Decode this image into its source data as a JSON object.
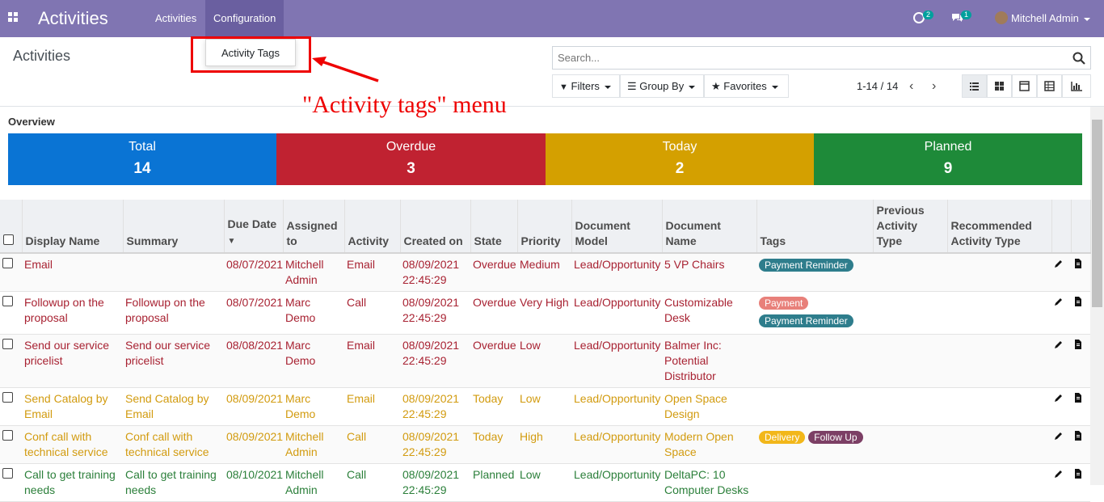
{
  "navbar": {
    "brand": "Activities",
    "menus": [
      "Activities",
      "Configuration"
    ],
    "activity_badge": "2",
    "messages_badge": "1",
    "user_name": "Mitchell Admin"
  },
  "dropdown": {
    "item": "Activity Tags"
  },
  "annotation": "\"Activity tags\" menu",
  "control_panel": {
    "title": "Activities",
    "search_placeholder": "Search...",
    "filters": "Filters",
    "group_by": "Group By",
    "favorites": "Favorites",
    "pager": "1-14 / 14"
  },
  "overview": {
    "label": "Overview",
    "stats": [
      {
        "label": "Total",
        "value": "14",
        "color": "#0a74d4"
      },
      {
        "label": "Overdue",
        "value": "3",
        "color": "#c02231"
      },
      {
        "label": "Today",
        "value": "2",
        "color": "#d4a000"
      },
      {
        "label": "Planned",
        "value": "9",
        "color": "#1e8a39"
      }
    ]
  },
  "table": {
    "headers": [
      "Display Name",
      "Summary",
      "Due Date",
      "Assigned to",
      "Activity",
      "Created on",
      "State",
      "Priority",
      "Document Model",
      "Document Name",
      "Tags",
      "Previous Activity Type",
      "Recommended Activity Type"
    ],
    "rows": [
      {
        "display_name": "Email",
        "summary": "",
        "due_date": "08/07/2021",
        "assigned_to": "Mitchell Admin",
        "activity": "Email",
        "created_on": "08/09/2021 22:45:29",
        "state": "Overdue",
        "priority": "Medium",
        "model": "Lead/Opportunity",
        "doc_name": "5 VP Chairs",
        "tags": [
          "Payment Reminder"
        ]
      },
      {
        "display_name": "Followup on the proposal",
        "summary": "Followup on the proposal",
        "due_date": "08/07/2021",
        "assigned_to": "Marc Demo",
        "activity": "Call",
        "created_on": "08/09/2021 22:45:29",
        "state": "Overdue",
        "priority": "Very High",
        "model": "Lead/Opportunity",
        "doc_name": "Customizable Desk",
        "tags": [
          "Payment",
          "Payment Reminder"
        ]
      },
      {
        "display_name": "Send our service pricelist",
        "summary": "Send our service pricelist",
        "due_date": "08/08/2021",
        "assigned_to": "Marc Demo",
        "activity": "Email",
        "created_on": "08/09/2021 22:45:29",
        "state": "Overdue",
        "priority": "Low",
        "model": "Lead/Opportunity",
        "doc_name": "Balmer Inc: Potential Distributor",
        "tags": []
      },
      {
        "display_name": "Send Catalog by Email",
        "summary": "Send Catalog by Email",
        "due_date": "08/09/2021",
        "assigned_to": "Marc Demo",
        "activity": "Email",
        "created_on": "",
        "state": "Today",
        "priority": "Low",
        "model": "Lead/Opportunity",
        "doc_name": "Open Space Design",
        "tags": []
      },
      {
        "display_name": "Conf call with technical service",
        "summary": "Conf call with technical service",
        "due_date": "08/09/2021",
        "assigned_to": "Mitchell Admin",
        "activity": "Call",
        "created_on": "08/09/2021 22:45:29",
        "state": "Today",
        "priority": "High",
        "model": "Lead/Opportunity",
        "doc_name": "Modern Open Space",
        "tags": [
          "Delivery",
          "Follow Up"
        ]
      },
      {
        "display_name": "Call to get training needs",
        "summary": "Call to get training needs",
        "due_date": "08/10/2021",
        "assigned_to": "Mitchell Admin",
        "activity": "Call",
        "created_on": "08/09/2021 22:45:29",
        "state": "Planned",
        "priority": "Low",
        "model": "Lead/Opportunity",
        "doc_name": "DeltaPC: 10 Computer Desks",
        "tags": []
      }
    ]
  }
}
